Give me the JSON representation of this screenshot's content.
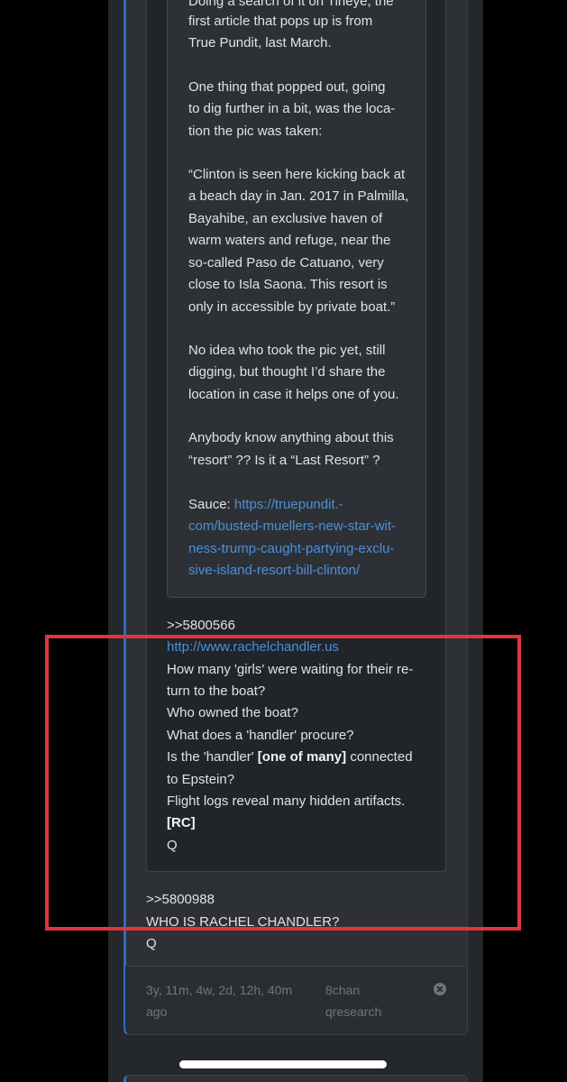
{
  "quoted_post": {
    "lines": [
      "Doing a search of it on Tineye, the",
      "first article that pops up is from",
      "True Pundit, last March.",
      "One thing that popped out, going",
      "to dig further in a bit, was the loca-",
      "tion the pic was taken:",
      "“Clinton is seen here kicking back at",
      "a beach day in Jan. 2017 in Palmilla,",
      "Bayahibe, an exclusive haven of",
      "warm waters and refuge, near the",
      "so-called Paso de Catuano, very",
      "close to Isla Saona. This resort is",
      "only in accessible by private boat.”",
      "No idea who took the pic yet, still",
      "digging, but thought I’d share the",
      "location in case it helps one of you.",
      "Anybody know anything about this",
      "“resort” ?? Is it a “Last Resort” ?"
    ],
    "sauce_label": "Sauce:",
    "sauce_link_lines": [
      "https://truepundit.-",
      "com/busted-muellers-new-star-wit-",
      "ness-trump-caught-partying-exclu-",
      "sive-island-resort-bill-clinton/"
    ]
  },
  "q_post": {
    "ref": ">>5800566",
    "link": "http://www.rachelchandler.us",
    "lines": [
      "How many 'girls' were waiting for their re-",
      "turn to the boat?",
      "Who owned the boat?",
      "What does a 'handler' procure?"
    ],
    "handler_prefix": "Is the 'handler'",
    "handler_bold": "[one of many]",
    "handler_suffix": "connected",
    "after_lines": [
      "to Epstein?",
      "Flight logs reveal many hidden artifacts."
    ],
    "rc": "[RC]",
    "signature": "Q"
  },
  "outer_post": {
    "ref": ">>5800988",
    "question": "WHO IS RACHEL CHANDLER?",
    "signature": "Q"
  },
  "footer": {
    "time_line1": "3y, 11m, 4w, 2d, 12h, 40m",
    "time_line2": "ago",
    "board_line1": "8chan",
    "board_line2": "qresearch",
    "close_icon": "close-circle-icon"
  },
  "colors": {
    "accent_blue": "#2f6cc4",
    "link_blue": "#4c8fd9",
    "highlight_red": "#e0353d"
  }
}
